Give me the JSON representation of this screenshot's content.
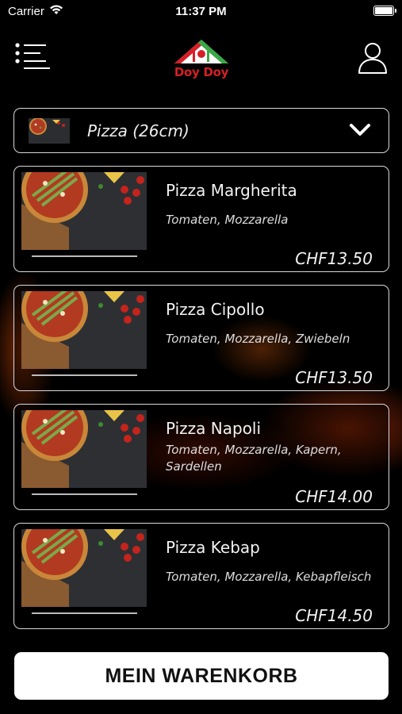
{
  "status_bar": {
    "carrier": "Carrier",
    "time": "11:37 PM"
  },
  "header": {
    "logo_text": "Doy Doy",
    "menu_icon": "hamburger-list-icon",
    "profile_icon": "user-profile-icon",
    "brand_colors": {
      "red": "#d61f26",
      "green": "#3aa845"
    }
  },
  "category": {
    "selected": "Pizza (26cm)",
    "dropdown_icon": "chevron-down-icon"
  },
  "products": [
    {
      "name": "Pizza Margherita",
      "description": "Tomaten, Mozzarella",
      "price": "CHF13.50"
    },
    {
      "name": "Pizza Cipollo",
      "description": "Tomaten, Mozzarella, Zwiebeln",
      "price": "CHF13.50"
    },
    {
      "name": "Pizza Napoli",
      "description": "Tomaten, Mozzarella, Kapern, Sardellen",
      "price": "CHF14.00"
    },
    {
      "name": "Pizza Kebap",
      "description": "Tomaten, Mozzarella, Kebapfleisch",
      "price": "CHF14.50"
    }
  ],
  "cart": {
    "label": "MEIN WARENKORB"
  }
}
